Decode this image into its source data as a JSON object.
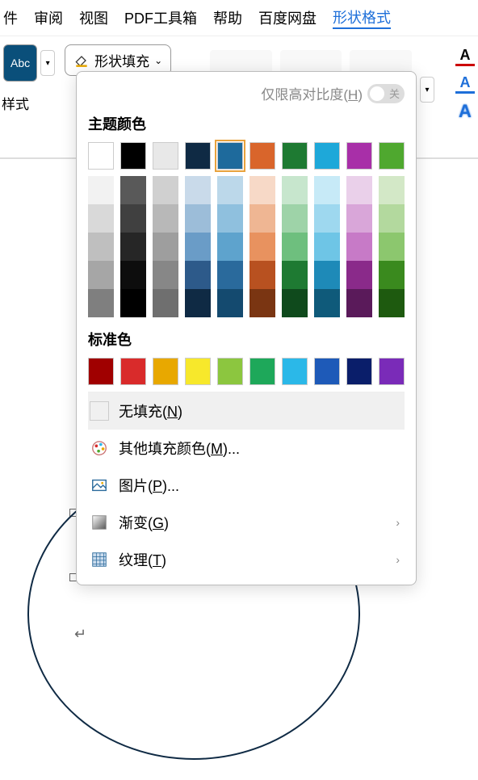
{
  "menubar": {
    "items": [
      "件",
      "审阅",
      "视图",
      "PDF工具箱",
      "帮助",
      "百度网盘",
      "形状格式"
    ],
    "active_index": 6
  },
  "toolbar": {
    "abc_label": "Abc",
    "fill_label": "形状填充",
    "style_label": "样式"
  },
  "popup": {
    "contrast_label": "仅限高对比度(",
    "contrast_hotkey": "H",
    "contrast_suffix": ")",
    "toggle_state": "关",
    "theme_title": "主题颜色",
    "standard_title": "标准色",
    "theme_colors": [
      "#ffffff",
      "#000000",
      "#e8e8e8",
      "#0f2a44",
      "#1e6a9c",
      "#d9652b",
      "#1e7a32",
      "#1ea8d9",
      "#a82fa8",
      "#4fa82f"
    ],
    "selected_theme_index": 4,
    "shades": [
      [
        "#f2f2f2",
        "#d9d9d9",
        "#bfbfbf",
        "#a6a6a6",
        "#7f7f7f"
      ],
      [
        "#595959",
        "#404040",
        "#262626",
        "#0d0d0d",
        "#000000"
      ],
      [
        "#d0d0d0",
        "#b8b8b8",
        "#9e9e9e",
        "#878787",
        "#6f6f6f"
      ],
      [
        "#c9daea",
        "#9cbdd9",
        "#6a9cc7",
        "#2d5a8a",
        "#0f2a44"
      ],
      [
        "#bcd8ea",
        "#8fc0de",
        "#5ea3cd",
        "#2a6a9c",
        "#144a6f"
      ],
      [
        "#f7d9c7",
        "#efb693",
        "#e8925f",
        "#b85120",
        "#7a3512"
      ],
      [
        "#c7e6cd",
        "#9ed3a8",
        "#6ebf7e",
        "#1e7a32",
        "#0f4a1c"
      ],
      [
        "#c7eaf7",
        "#9ed8ef",
        "#6ec5e6",
        "#1e8ab8",
        "#0f5a7a"
      ],
      [
        "#ead0ea",
        "#d9a6d9",
        "#c77ac7",
        "#8a2a8a",
        "#5a1a5a"
      ],
      [
        "#d3e8c7",
        "#b3d99e",
        "#8cc76e",
        "#3a8a1e",
        "#1e5a0f"
      ]
    ],
    "standard_colors": [
      "#a00000",
      "#d92b2b",
      "#e8a800",
      "#f7e82b",
      "#8cc63f",
      "#1ea85a",
      "#2bb8e8",
      "#1e5ab8",
      "#0a1e6a",
      "#7a2bb8"
    ],
    "options": {
      "no_fill": {
        "label": "无填充(",
        "hotkey": "N",
        "suffix": ")"
      },
      "more_colors": {
        "label": "其他填充颜色(",
        "hotkey": "M",
        "suffix": ")..."
      },
      "picture": {
        "label": "图片(",
        "hotkey": "P",
        "suffix": ")..."
      },
      "gradient": {
        "label": "渐变(",
        "hotkey": "G",
        "suffix": ")"
      },
      "texture": {
        "label": "纹理(",
        "hotkey": "T",
        "suffix": ")"
      }
    }
  }
}
